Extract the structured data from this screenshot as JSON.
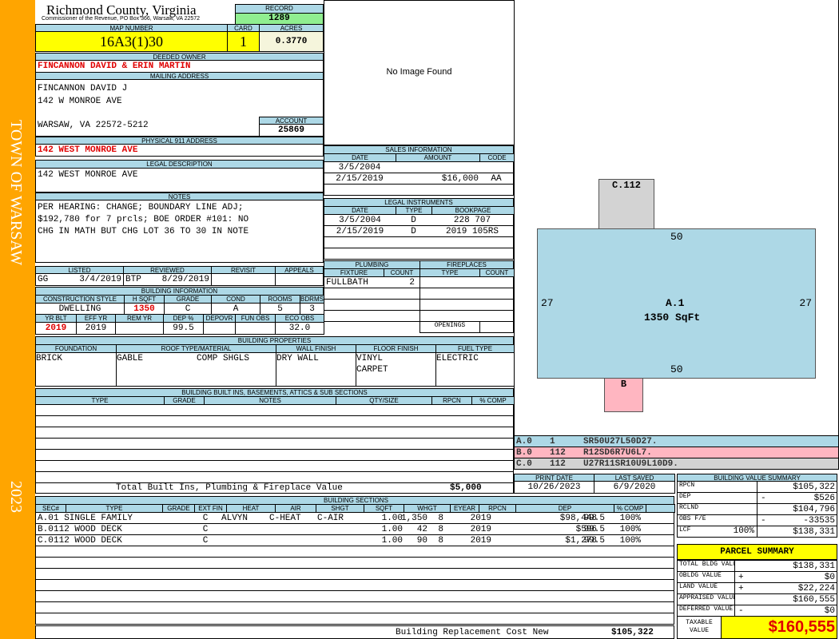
{
  "sidebar": {
    "town": "TOWN OF WARSAW",
    "year": "2023"
  },
  "header": {
    "county": "Richmond County, Virginia",
    "subtitle": "Commissioner of the Revenue, PO Box 366, Warsaw, VA 22572",
    "record_label": "RECORD",
    "record": "1289"
  },
  "parcel": {
    "map_label": "MAP NUMBER",
    "map": "16A3(1)30",
    "card_label": "CARD",
    "card": "1",
    "acres_label": "ACRES",
    "acres": "0.3770"
  },
  "owner": {
    "label": "DEEDED OWNER",
    "value": "FINCANNON DAVID & ERIN MARTIN"
  },
  "mailing": {
    "label": "MAILING ADDRESS",
    "line1": "FINCANNON DAVID J",
    "line2": "142 W MONROE AVE",
    "line3": "WARSAW, VA 22572-5212",
    "account_label": "ACCOUNT",
    "account": "25869"
  },
  "physical": {
    "label": "PHYSICAL 911 ADDRESS",
    "value": "142 WEST MONROE AVE"
  },
  "legal": {
    "label": "LEGAL DESCRIPTION",
    "value": "142 WEST MONROE AVE"
  },
  "notes": {
    "label": "NOTES",
    "lines": [
      "PER HEARING: CHANGE; BOUNDARY LINE ADJ;",
      "$192,780 for 7 prcls; BOE ORDER #101: NO",
      "CHG IN MATH BUT CHG LOT 36 TO 30 IN NOTE"
    ]
  },
  "review": {
    "listed_label": "LISTED",
    "listed_by": "GG",
    "listed_date": "3/4/2019",
    "reviewed_label": "REVIEWED",
    "reviewed_by": "BTP",
    "reviewed_date": "8/29/2019",
    "revisit_label": "REVISIT",
    "appeals_label": "APPEALS"
  },
  "building_info": {
    "label": "BUILDING INFORMATION",
    "h1": [
      "CONSTRUCTION STYLE",
      "H SQFT",
      "GRADE",
      "COND",
      "ROOMS",
      "BDRMS"
    ],
    "v1": [
      "DWELLING",
      "1350",
      "C",
      "A",
      "5",
      "3"
    ],
    "h2": [
      "YR BLT",
      "EFF YR",
      "REM YR",
      "DEP %",
      "DEPOVR",
      "FUN OBS",
      "ECO OBS"
    ],
    "v2": [
      "2019",
      "2019",
      "",
      "99.5",
      "",
      "",
      "32.0"
    ]
  },
  "image": {
    "text": "No Image Found"
  },
  "sales": {
    "label": "SALES INFORMATION",
    "cols": [
      "DATE",
      "AMOUNT",
      "CODE"
    ],
    "rows": [
      [
        "3/5/2004",
        "",
        ""
      ],
      [
        "2/15/2019",
        "$16,000",
        "AA"
      ]
    ]
  },
  "instruments": {
    "label": "LEGAL INSTRUMENTS",
    "cols": [
      "DATE",
      "TYPE",
      "BOOKPAGE"
    ],
    "rows": [
      [
        "3/5/2004",
        "D",
        "228 707"
      ],
      [
        "2/15/2019",
        "D",
        "2019 105RS"
      ]
    ]
  },
  "plumbing": {
    "label": "PLUMBING",
    "cols": [
      "FIXTURE",
      "COUNT"
    ],
    "rows": [
      [
        "FULLBATH",
        "2"
      ]
    ]
  },
  "fireplaces": {
    "label": "FIREPLACES",
    "cols": [
      "TYPE",
      "COUNT"
    ],
    "openings": "OPENINGS"
  },
  "properties": {
    "label": "BUILDING PROPERTIES",
    "cols": [
      "FOUNDATION",
      "ROOF TYPE/MATERIAL",
      "WALL FINISH",
      "FLOOR FINISH",
      "FUEL TYPE"
    ],
    "foundation": "BRICK",
    "roof_type": "GABLE",
    "roof_material": "COMP SHGLS",
    "wall": "DRY WALL",
    "floor1": "VINYL",
    "floor2": "CARPET",
    "fuel": "ELECTRIC"
  },
  "builtins": {
    "label": "BUILDING BUILT INS, BASEMENTS, ATTICS & SUB SECTIONS",
    "cols": [
      "TYPE",
      "GRADE",
      "NOTES",
      "QTY/SIZE",
      "RPCN",
      "% COMP"
    ],
    "total_label": "Total Built Ins, Plumbing & Fireplace Value",
    "total": "$5,000"
  },
  "sections": {
    "label": "BUILDING SECTIONS",
    "cols": [
      "SEC#",
      "TYPE",
      "GRADE",
      "EXT FIN",
      "HEAT",
      "AIR",
      "SHGT",
      "SQFT",
      "WHGT",
      "EYEAR",
      "RPCN",
      "DEP",
      "% COMP"
    ],
    "rows": [
      [
        "A.0",
        "1 SINGLE FAMILY",
        "C",
        "ALVYN",
        "C-HEAT",
        "C-AIR",
        "1.00",
        "1,350",
        "8",
        "2019",
        "$98,448",
        "99.5",
        "100%"
      ],
      [
        "B.0",
        "112 WOOD DECK",
        "C",
        "",
        "",
        "",
        "1.00",
        "42",
        "8",
        "2019",
        "$596",
        "99.5",
        "100%"
      ],
      [
        "C.0",
        "112 WOOD DECK",
        "C",
        "",
        "",
        "",
        "1.00",
        "90",
        "8",
        "2019",
        "$1,278",
        "99.5",
        "100%"
      ]
    ],
    "total_label": "Building Replacement Cost New",
    "total": "$105,322"
  },
  "sketch": {
    "a_label": "A.1",
    "a_area": "1350 SqFt",
    "top": "50",
    "bottom": "50",
    "left": "27",
    "right": "27",
    "b_label": "B",
    "c_label": "C.112",
    "legend": [
      [
        "A.0",
        "1",
        "SR50U27L50D27."
      ],
      [
        "B.0",
        "112",
        "R12SD6R7U6L7."
      ],
      [
        "C.0",
        "112",
        "U27R11SR10U9L10D9."
      ]
    ],
    "colors": {
      "a": "#add8e6",
      "b": "#ffb6c1",
      "c": "#d3d3d3"
    }
  },
  "dates": {
    "print_label": "PRINT DATE",
    "print": "10/26/2023",
    "saved_label": "LAST SAVED",
    "saved": "6/9/2020"
  },
  "value_summary": {
    "label": "BUILDING VALUE SUMMARY",
    "rows": [
      [
        "RPCN",
        "",
        "$105,322"
      ],
      [
        "DEP",
        "-",
        "$526"
      ],
      [
        "RCLND",
        "",
        "$104,796"
      ],
      [
        "OBS F/E",
        "-",
        "-33535"
      ],
      [
        "LCF",
        "100%",
        "$138,331"
      ]
    ]
  },
  "parcel_summary": {
    "label": "PARCEL SUMMARY",
    "rows": [
      [
        "TOTAL BLDG VALUE",
        "",
        "$138,331"
      ],
      [
        "OBLDG VALUE",
        "+",
        "$0"
      ],
      [
        "LAND VALUE",
        "+",
        "$22,224"
      ],
      [
        "APPRAISED VALUE",
        "",
        "$160,555"
      ],
      [
        "DEFERRED VALUE",
        "-",
        "$0"
      ]
    ],
    "taxable_label": "TAXABLE VALUE",
    "taxable": "$160,555"
  }
}
